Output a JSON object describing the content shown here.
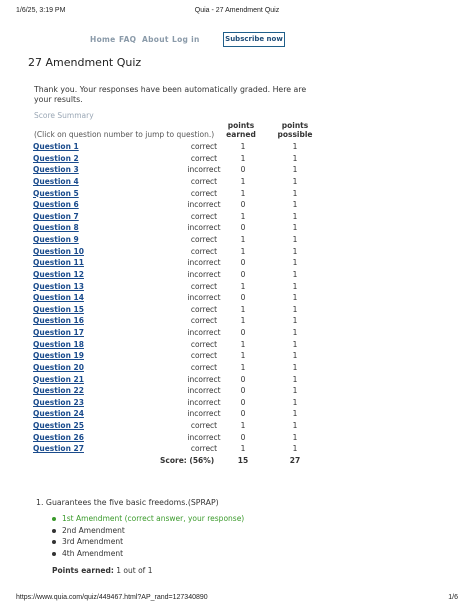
{
  "print_header": {
    "datetime": "1/6/25, 3:19 PM",
    "doc_title": "Quia - 27 Amendment Quiz"
  },
  "nav": {
    "home": "Home",
    "faq": "FAQ",
    "about": "About",
    "login": "Log in",
    "subscribe": "Subscribe now"
  },
  "quiz": {
    "title": "27 Amendment Quiz",
    "thanks": "Thank you. Your responses have been automatically graded. Here are your results."
  },
  "summary": {
    "heading": "Score Summary",
    "click_note": "(Click on question number to jump to question.)",
    "col_earned_1": "points",
    "col_earned_2": "earned",
    "col_possible_1": "points",
    "col_possible_2": "possible",
    "rows": [
      {
        "q": "Question 1",
        "status": "correct",
        "earned": "1",
        "possible": "1"
      },
      {
        "q": "Question 2",
        "status": "correct",
        "earned": "1",
        "possible": "1"
      },
      {
        "q": "Question 3",
        "status": "incorrect",
        "earned": "0",
        "possible": "1"
      },
      {
        "q": "Question 4",
        "status": "correct",
        "earned": "1",
        "possible": "1"
      },
      {
        "q": "Question 5",
        "status": "correct",
        "earned": "1",
        "possible": "1"
      },
      {
        "q": "Question 6",
        "status": "incorrect",
        "earned": "0",
        "possible": "1"
      },
      {
        "q": "Question 7",
        "status": "correct",
        "earned": "1",
        "possible": "1"
      },
      {
        "q": "Question 8",
        "status": "incorrect",
        "earned": "0",
        "possible": "1"
      },
      {
        "q": "Question 9",
        "status": "correct",
        "earned": "1",
        "possible": "1"
      },
      {
        "q": "Question 10",
        "status": "correct",
        "earned": "1",
        "possible": "1"
      },
      {
        "q": "Question 11",
        "status": "incorrect",
        "earned": "0",
        "possible": "1"
      },
      {
        "q": "Question 12",
        "status": "incorrect",
        "earned": "0",
        "possible": "1"
      },
      {
        "q": "Question 13",
        "status": "correct",
        "earned": "1",
        "possible": "1"
      },
      {
        "q": "Question 14",
        "status": "incorrect",
        "earned": "0",
        "possible": "1"
      },
      {
        "q": "Question 15",
        "status": "correct",
        "earned": "1",
        "possible": "1"
      },
      {
        "q": "Question 16",
        "status": "correct",
        "earned": "1",
        "possible": "1"
      },
      {
        "q": "Question 17",
        "status": "incorrect",
        "earned": "0",
        "possible": "1"
      },
      {
        "q": "Question 18",
        "status": "correct",
        "earned": "1",
        "possible": "1"
      },
      {
        "q": "Question 19",
        "status": "correct",
        "earned": "1",
        "possible": "1"
      },
      {
        "q": "Question 20",
        "status": "correct",
        "earned": "1",
        "possible": "1"
      },
      {
        "q": "Question 21",
        "status": "incorrect",
        "earned": "0",
        "possible": "1"
      },
      {
        "q": "Question 22",
        "status": "incorrect",
        "earned": "0",
        "possible": "1"
      },
      {
        "q": "Question 23",
        "status": "incorrect",
        "earned": "0",
        "possible": "1"
      },
      {
        "q": "Question 24",
        "status": "incorrect",
        "earned": "0",
        "possible": "1"
      },
      {
        "q": "Question 25",
        "status": "correct",
        "earned": "1",
        "possible": "1"
      },
      {
        "q": "Question 26",
        "status": "incorrect",
        "earned": "0",
        "possible": "1"
      },
      {
        "q": "Question 27",
        "status": "correct",
        "earned": "1",
        "possible": "1"
      }
    ],
    "total": {
      "label": "Score: (56%)",
      "earned": "15",
      "possible": "27"
    }
  },
  "question_1": {
    "text": "1. Guarantees the five basic freedoms.(SPRAP)",
    "answers": [
      {
        "label": "1st Amendment (correct answer, your response)",
        "correct": true
      },
      {
        "label": "2nd Amendment",
        "correct": false
      },
      {
        "label": "3rd Amendment",
        "correct": false
      },
      {
        "label": "4th Amendment",
        "correct": false
      }
    ],
    "points_label": "Points earned:",
    "points_value": "1 out of 1"
  },
  "print_footer": {
    "url": "https://www.quia.com/quiz/449467.html?AP_rand=127340890",
    "page": "1/6"
  },
  "colors": {
    "link": "#1a4b8c",
    "correct_green": "#3a9a2b",
    "nav_gray": "#8a9aa9",
    "subscribe_border": "#1f5f8a"
  }
}
